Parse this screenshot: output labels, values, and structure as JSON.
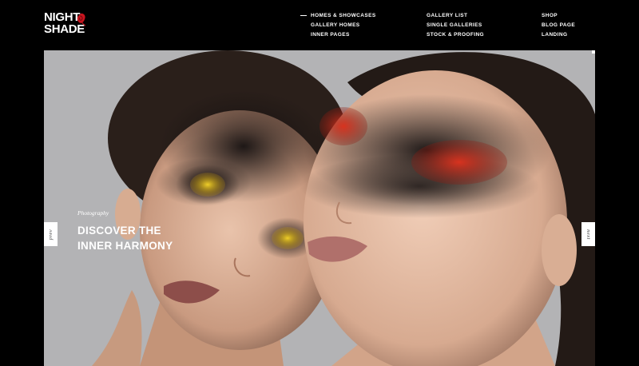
{
  "brand": {
    "line1": "NIGHT",
    "line2": "SHADE",
    "accent_color": "#c8141e"
  },
  "nav": {
    "col1": [
      "HOMES & SHOWCASES",
      "GALLERY HOMES",
      "INNER PAGES"
    ],
    "col2": [
      "GALLERY LIST",
      "SINGLE GALLERIES",
      "STOCK & PROOFING"
    ],
    "col3": [
      "SHOP",
      "BLOG PAGE",
      "LANDING"
    ],
    "active_item": "HOMES & SHOWCASES"
  },
  "hero": {
    "kicker": "Photography",
    "title": "DISCOVER THE INNER HARMONY",
    "prev_label": "prev",
    "next_label": "next",
    "background_color": "#b3b3b5"
  },
  "colors": {
    "background": "#000000",
    "text": "#ffffff",
    "yellow_makeup": "#e5c21a",
    "red_makeup": "#c8291a"
  }
}
